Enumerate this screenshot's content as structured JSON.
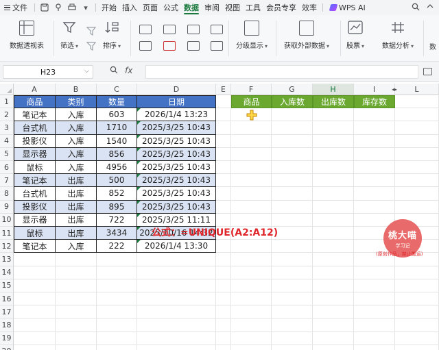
{
  "menu": {
    "file": "文件",
    "tabs": [
      "开始",
      "插入",
      "页面",
      "公式",
      "数据",
      "审阅",
      "视图",
      "工具",
      "会员专享",
      "效率"
    ],
    "active_tab": "数据",
    "wps_ai": "WPS AI"
  },
  "ribbon": {
    "pivot": "数据透视表",
    "filter": "筛选",
    "sort": "排序",
    "group": "分级显示",
    "external": "获取外部数据",
    "stock": "股票",
    "analysis": "数据分析",
    "cut_label": "数"
  },
  "formula_bar": {
    "name_box": "H23",
    "fx": "fx",
    "content": ""
  },
  "columns": [
    "A",
    "B",
    "C",
    "D",
    "E",
    "F",
    "G",
    "H",
    "I",
    "L"
  ],
  "selected_column": "H",
  "rows": [
    "1",
    "2",
    "3",
    "4",
    "5",
    "6",
    "7",
    "8",
    "9",
    "10",
    "11",
    "12",
    "13",
    "14",
    "15",
    "16",
    "17",
    "18",
    "19",
    "20"
  ],
  "table": {
    "headers": [
      "商品",
      "类别",
      "数量",
      "日期"
    ],
    "rows": [
      [
        "笔记本",
        "入库",
        "603",
        "2026/1/4 13:23"
      ],
      [
        "台式机",
        "入库",
        "1710",
        "2025/3/25 10:43"
      ],
      [
        "投影仪",
        "入库",
        "1540",
        "2025/3/25 10:43"
      ],
      [
        "显示器",
        "入库",
        "856",
        "2025/3/25 10:43"
      ],
      [
        "鼠标",
        "入库",
        "4956",
        "2025/3/25 10:43"
      ],
      [
        "笔记本",
        "出库",
        "500",
        "2025/3/25 10:43"
      ],
      [
        "台式机",
        "出库",
        "852",
        "2025/3/25 10:43"
      ],
      [
        "投影仪",
        "出库",
        "895",
        "2025/3/25 10:43"
      ],
      [
        "显示器",
        "出库",
        "722",
        "2025/3/25 11:11"
      ],
      [
        "鼠标",
        "出库",
        "3434",
        "2025/10/16 14:32"
      ],
      [
        "笔记本",
        "入库",
        "222",
        "2026/1/4 13:30"
      ]
    ]
  },
  "summary_headers": [
    "商品",
    "入库数",
    "出库数",
    "库存数"
  ],
  "annotation": {
    "formula": "公式：=UNIQUE(A2:A12)"
  },
  "stamp": {
    "title": "桃大喵",
    "subtitle": "学习记",
    "note": "(原创作品，禁止搬运)"
  },
  "colors": {
    "accent": "#1b7a3e",
    "table_header": "#4472c4",
    "table_band": "#dae3f3",
    "summary_header": "#6aa82f",
    "formula_text": "#e0262a"
  }
}
